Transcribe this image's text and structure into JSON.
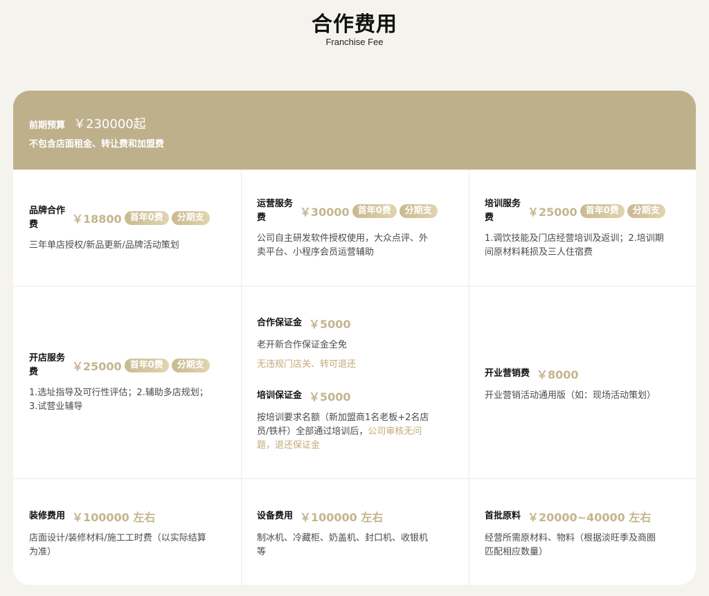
{
  "title": "合作费用",
  "subtitle": "Franchise Fee",
  "header": {
    "budget_label": "前期预算",
    "budget_amount": "￥230000起",
    "budget_note": "不包含店面租金、转让费和加盟费"
  },
  "tags": {
    "free_first_year": "首年0费",
    "installment": "分期支"
  },
  "items": {
    "brand": {
      "name_line1": "品牌合作",
      "name_line2": "费",
      "price": "￥18800",
      "desc": "三年单店授权/新品更新/品牌活动策划"
    },
    "operation": {
      "name_line1": "运营服务",
      "name_line2": "费",
      "price": "￥30000",
      "desc_line1": "公司自主研发软件授权使用，大众点评、外",
      "desc_line2": "卖平台、小程序会员运营辅助"
    },
    "training": {
      "name_line1": "培训服务",
      "name_line2": "费",
      "price": "￥25000",
      "desc_line1": "1.调饮技能及门店经营培训及返训；2.培训期",
      "desc_line2": "间原材料耗损及三人住宿费"
    },
    "opening": {
      "name_line1": "开店服务",
      "name_line2": "费",
      "price": "￥25000",
      "desc_line1": "1.选址指导及可行性评估；2.辅助多店规划；",
      "desc_line2": "3.试营业辅导"
    },
    "deposit": {
      "name": "合作保证金",
      "price": "￥5000",
      "desc": "老开新合作保证金全免",
      "note": "无违规门店关、转可退还"
    },
    "training_deposit": {
      "name": "培训保证金",
      "price": "￥5000",
      "desc_line1": "按培训要求名额（新加盟商1名老板+2名店",
      "desc_line2a": "员/铁杆）全部通过培训后，",
      "desc_line2b": "公司审核无问",
      "desc_line3": "题，退还保证金"
    },
    "marketing": {
      "name": "开业营销费",
      "price": "￥8000",
      "desc": "开业营销活动通用版（如：现场活动策划）"
    },
    "renovation": {
      "name": "装修费用",
      "price": "￥100000 左右",
      "desc_line1": "店面设计/装修材料/施工工时费（以实际结算",
      "desc_line2": "为准）"
    },
    "equipment": {
      "name": "设备费用",
      "price": "￥100000 左右",
      "desc_line1": "制冰机、冷藏柜、奶盖机、封口机、收银机",
      "desc_line2": "等"
    },
    "materials": {
      "name": "首批原料",
      "price": "￥20000~40000 左右",
      "desc_line1": "经营所需原材料、物料（根据淡旺季及商圈",
      "desc_line2": "匹配相应数量）"
    }
  },
  "colors": {
    "background": "#f5f3ee",
    "header": "#bfb08c",
    "accent_gold": "#c4b58f",
    "tag_gradient_start": "#c9b98f",
    "tag_gradient_end": "#e1d4b0"
  }
}
